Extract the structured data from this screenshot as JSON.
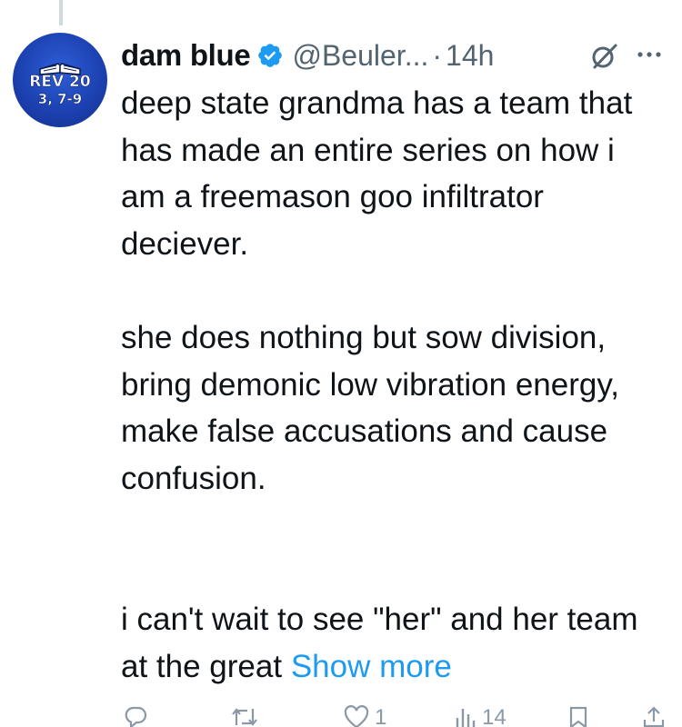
{
  "tweet": {
    "avatar": {
      "line1": "REV 20",
      "line2": "3, 7-9",
      "icon": "open-bible-icon"
    },
    "display_name": "dam blue",
    "verified_icon": "verified-badge-icon",
    "handle": "@Beuler...",
    "separator": "·",
    "time": "14h",
    "paragraphs": [
      "deep state grandma has a team that has made an entire series on how i am a freemason goo infiltrator deciever.",
      "she does nothing but sow division, bring demonic low vibration energy, make false accusations and cause confusion.",
      "i can't wait to see \"her\" and her team at the great"
    ],
    "show_more": "Show more"
  },
  "actions": {
    "reply": {
      "icon": "reply-icon",
      "count": ""
    },
    "retweet": {
      "icon": "retweet-icon",
      "count": ""
    },
    "like": {
      "icon": "heart-icon",
      "count": "1"
    },
    "views": {
      "icon": "views-chart-icon",
      "count": "14"
    },
    "bookmark": {
      "icon": "bookmark-icon",
      "count": ""
    },
    "share": {
      "icon": "share-icon",
      "count": ""
    }
  },
  "colors": {
    "link": "#1d9bf0",
    "muted": "#536471",
    "text": "#0f1419",
    "verified": "#1d9bf0"
  }
}
